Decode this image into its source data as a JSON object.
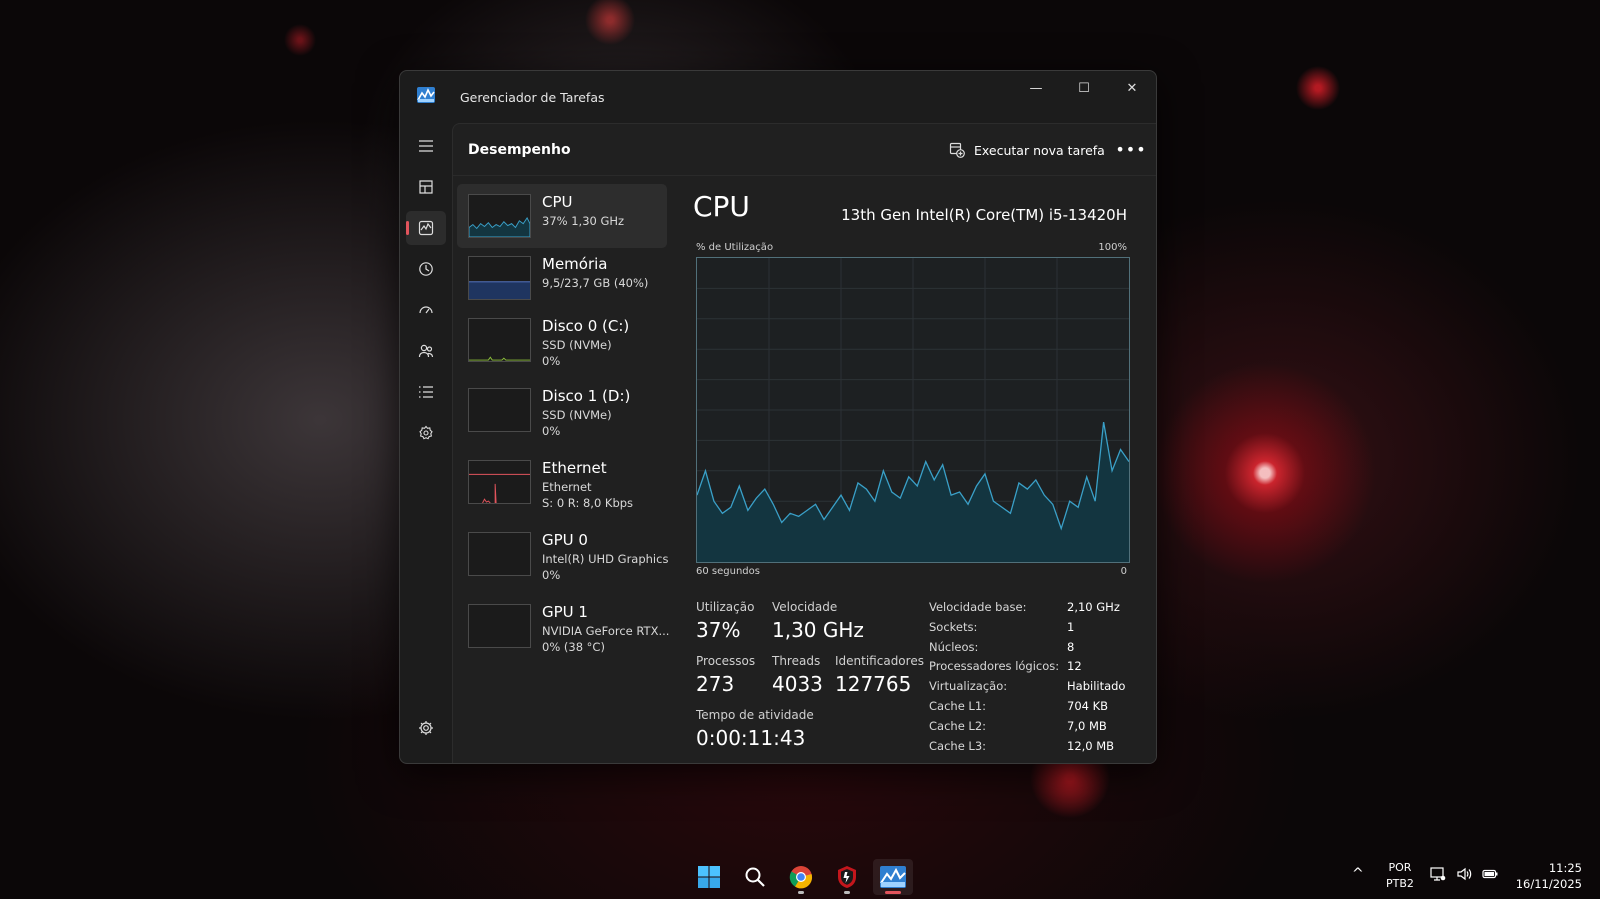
{
  "window": {
    "title": "Gerenciador de Tarefas",
    "minimize_glyph": "—",
    "maximize_glyph": "☐",
    "close_glyph": "✕"
  },
  "nav": {
    "items": [
      {
        "icon": "hamburger-menu-icon"
      },
      {
        "icon": "processes-icon"
      },
      {
        "icon": "performance-icon",
        "active": true
      },
      {
        "icon": "app-history-icon"
      },
      {
        "icon": "startup-apps-icon"
      },
      {
        "icon": "users-icon"
      },
      {
        "icon": "details-icon"
      },
      {
        "icon": "services-icon"
      }
    ],
    "settings_icon": "gear-icon"
  },
  "header": {
    "title": "Desempenho",
    "run_task_label": "Executar nova tarefa",
    "more_glyph": "•••"
  },
  "devices": [
    {
      "name": "CPU",
      "line1": "37%  1,30 GHz",
      "line2": "",
      "active": true,
      "graph_color": "#3aa0c8"
    },
    {
      "name": "Memória",
      "line1": "9,5/23,7 GB (40%)",
      "line2": "",
      "graph_color": "#5b7fd6"
    },
    {
      "name": "Disco 0 (C:)",
      "line1": "SSD (NVMe)",
      "line2": "0%",
      "graph_color": "#8cbf3a"
    },
    {
      "name": "Disco 1 (D:)",
      "line1": "SSD (NVMe)",
      "line2": "0%",
      "graph_color": "#8cbf3a"
    },
    {
      "name": "Ethernet",
      "line1": "Ethernet",
      "line2": "S: 0 R: 8,0 Kbps",
      "graph_color": "#e2545c"
    },
    {
      "name": "GPU 0",
      "line1": "Intel(R) UHD Graphics",
      "line2": "0%",
      "graph_color": "#3aa0c8"
    },
    {
      "name": "GPU 1",
      "line1": "NVIDIA GeForce RTX...",
      "line2": "0%  (38 °C)",
      "graph_color": "#3aa0c8"
    }
  ],
  "cpu": {
    "title": "CPU",
    "model": "13th Gen Intel(R) Core(TM) i5-13420H",
    "graph_label_left": "% de Utilização",
    "graph_label_right": "100%",
    "graph_foot_left": "60 segundos",
    "graph_foot_right": "0",
    "graph_color": "#3aa0c8",
    "graph_fill": "#133540",
    "history_percent": [
      22,
      30,
      20,
      16,
      18,
      25,
      17,
      21,
      24,
      19,
      13,
      16,
      15,
      17,
      19,
      14,
      18,
      22,
      17,
      26,
      24,
      20,
      30,
      23,
      21,
      28,
      25,
      33,
      27,
      32,
      22,
      23,
      19,
      25,
      29,
      20,
      18,
      16,
      26,
      24,
      27,
      22,
      19,
      11,
      20,
      18,
      28,
      20,
      46,
      30,
      37,
      33
    ],
    "stats": {
      "utilizacao_label": "Utilização",
      "utilizacao": "37%",
      "velocidade_label": "Velocidade",
      "velocidade": "1,30 GHz",
      "processos_label": "Processos",
      "processos": "273",
      "threads_label": "Threads",
      "threads": "4033",
      "identificadores_label": "Identificadores",
      "identificadores": "127765",
      "uptime_label": "Tempo de atividade",
      "uptime": "0:00:11:43"
    },
    "specs": [
      {
        "k": "Velocidade base:",
        "v": "2,10 GHz"
      },
      {
        "k": "Sockets:",
        "v": "1"
      },
      {
        "k": "Núcleos:",
        "v": "8"
      },
      {
        "k": "Processadores lógicos:",
        "v": "12"
      },
      {
        "k": "Virtualização:",
        "v": "Habilitado"
      },
      {
        "k": "Cache L1:",
        "v": "704 KB"
      },
      {
        "k": "Cache L2:",
        "v": "7,0 MB"
      },
      {
        "k": "Cache L3:",
        "v": "12,0 MB"
      }
    ]
  },
  "taskbar": {
    "apps": [
      {
        "icon": "windows-start-icon"
      },
      {
        "icon": "search-icon"
      },
      {
        "icon": "chrome-icon",
        "running": true
      },
      {
        "icon": "shield-app-icon",
        "running": true
      },
      {
        "icon": "task-manager-icon",
        "active": true
      }
    ],
    "chevron_glyph": "^",
    "lang_line1": "POR",
    "lang_line2": "PTB2",
    "time": "11:25",
    "date": "16/11/2025"
  },
  "colors": {
    "accent": "#e2545c",
    "window_bg": "#1c1c1c",
    "content_bg": "#202020",
    "cpu_line": "#3aa0c8"
  }
}
